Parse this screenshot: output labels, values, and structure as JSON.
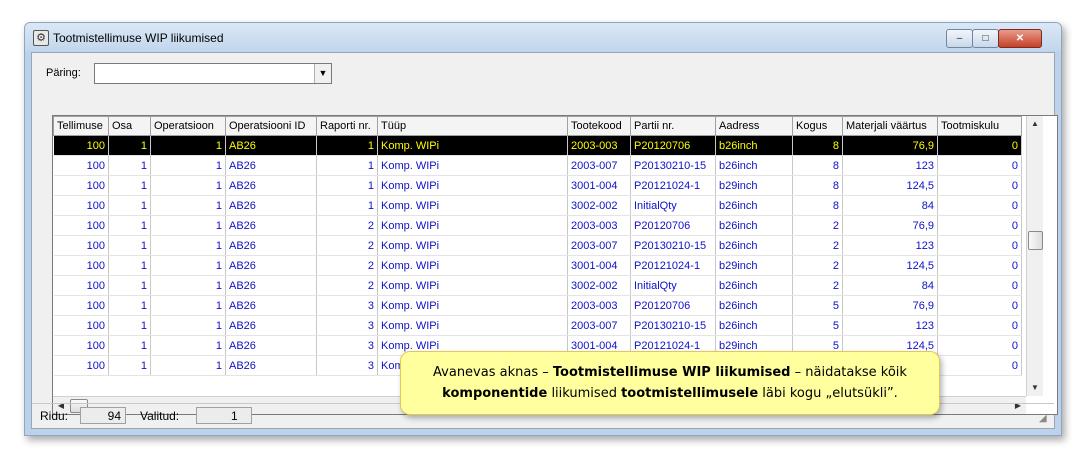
{
  "window": {
    "title": "Tootmistellimuse WIP liikumised",
    "controls": {
      "minimize": "‒",
      "maximize": "□",
      "close": "✕"
    }
  },
  "query": {
    "label": "Päring:",
    "value": ""
  },
  "grid": {
    "columns": [
      "Tellimuse",
      "Osa",
      "Operatsioon",
      "Operatsiooni ID",
      "Raporti nr.",
      "Tüüp",
      "Tootekood",
      "Partii nr.",
      "Aadress",
      "Kogus",
      "Materjali väärtus",
      "Tootmiskulu"
    ],
    "rows": [
      [
        "100",
        "1",
        "1",
        "AB26",
        "1",
        "Komp. WIPi",
        "2003-003",
        "P20120706",
        "b26inch",
        "8",
        "76,9",
        "0"
      ],
      [
        "100",
        "1",
        "1",
        "AB26",
        "1",
        "Komp. WIPi",
        "2003-007",
        "P20130210-15",
        "b26inch",
        "8",
        "123",
        "0"
      ],
      [
        "100",
        "1",
        "1",
        "AB26",
        "1",
        "Komp. WIPi",
        "3001-004",
        "P20121024-1",
        "b29inch",
        "8",
        "124,5",
        "0"
      ],
      [
        "100",
        "1",
        "1",
        "AB26",
        "1",
        "Komp. WIPi",
        "3002-002",
        "InitialQty",
        "b26inch",
        "8",
        "84",
        "0"
      ],
      [
        "100",
        "1",
        "1",
        "AB26",
        "2",
        "Komp. WIPi",
        "2003-003",
        "P20120706",
        "b26inch",
        "2",
        "76,9",
        "0"
      ],
      [
        "100",
        "1",
        "1",
        "AB26",
        "2",
        "Komp. WIPi",
        "2003-007",
        "P20130210-15",
        "b26inch",
        "2",
        "123",
        "0"
      ],
      [
        "100",
        "1",
        "1",
        "AB26",
        "2",
        "Komp. WIPi",
        "3001-004",
        "P20121024-1",
        "b29inch",
        "2",
        "124,5",
        "0"
      ],
      [
        "100",
        "1",
        "1",
        "AB26",
        "2",
        "Komp. WIPi",
        "3002-002",
        "InitialQty",
        "b26inch",
        "2",
        "84",
        "0"
      ],
      [
        "100",
        "1",
        "1",
        "AB26",
        "3",
        "Komp. WIPi",
        "2003-003",
        "P20120706",
        "b26inch",
        "5",
        "76,9",
        "0"
      ],
      [
        "100",
        "1",
        "1",
        "AB26",
        "3",
        "Komp. WIPi",
        "2003-007",
        "P20130210-15",
        "b26inch",
        "5",
        "123",
        "0"
      ],
      [
        "100",
        "1",
        "1",
        "AB26",
        "3",
        "Komp. WIPi",
        "3001-004",
        "P20121024-1",
        "b29inch",
        "5",
        "124,5",
        "0"
      ],
      [
        "100",
        "1",
        "1",
        "AB26",
        "3",
        "Kom",
        "",
        "",
        "",
        "",
        "",
        "0"
      ]
    ],
    "selected_row": 0
  },
  "status": {
    "rows_label": "Ridu:",
    "rows_value": "94",
    "selected_label": "Valitud:",
    "selected_value": "1"
  },
  "callout": {
    "t1": "Avanevas aknas – ",
    "b1": "Tootmistellimuse WIP liikumised",
    "t2": " – näidatakse kõik",
    "b2": "komponentide",
    "t3": " liikumised ",
    "b3": "tootmistellimusele",
    "t4": " läbi kogu „elutsükli”."
  },
  "colors": {
    "text_blue": "#1010c8",
    "selected_bg": "#000000",
    "selected_fg": "#ffff00",
    "callout_bg": "#ffff9e"
  },
  "icons": {
    "window": "gear-icon",
    "dropdown": "chevron-down-icon",
    "scroll_up": "arrow-up-icon",
    "scroll_down": "arrow-down-icon",
    "scroll_left": "arrow-left-icon",
    "scroll_right": "arrow-right-icon",
    "resize": "resize-grip-icon"
  }
}
